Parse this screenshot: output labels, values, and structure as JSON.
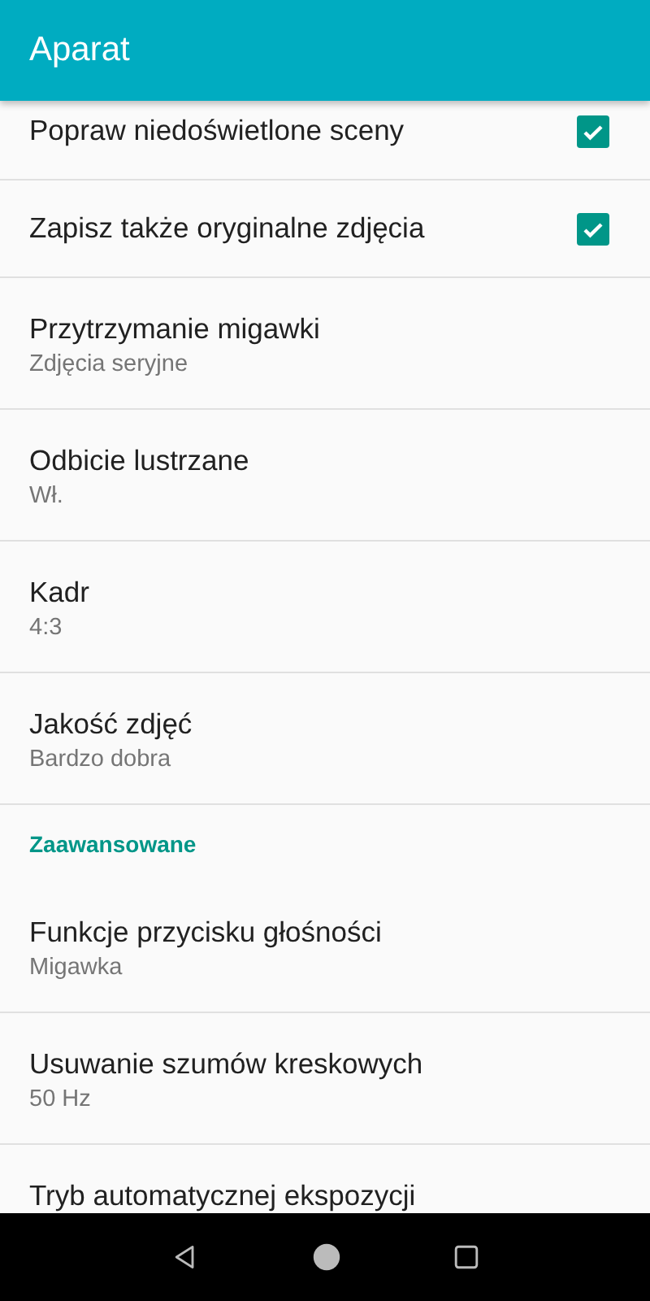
{
  "app_bar": {
    "title": "Aparat"
  },
  "settings": [
    {
      "kind": "checkbox",
      "title": "Popraw niedoświetlone sceny",
      "checked": true
    },
    {
      "kind": "checkbox",
      "title": "Zapisz także oryginalne zdjęcia",
      "checked": true
    },
    {
      "kind": "preference",
      "title": "Przytrzymanie migawki",
      "summary": "Zdjęcia seryjne"
    },
    {
      "kind": "preference",
      "title": "Odbicie lustrzane",
      "summary": "Wł."
    },
    {
      "kind": "preference",
      "title": "Kadr",
      "summary": "4:3"
    },
    {
      "kind": "preference",
      "title": "Jakość zdjęć",
      "summary": "Bardzo dobra"
    },
    {
      "kind": "category",
      "title": "Zaawansowane"
    },
    {
      "kind": "preference",
      "title": "Funkcje przycisku głośności",
      "summary": "Migawka"
    },
    {
      "kind": "preference",
      "title": "Usuwanie szumów kreskowych",
      "summary": "50 Hz"
    },
    {
      "kind": "preference",
      "title": "Tryb automatycznej ekspozycji"
    }
  ]
}
